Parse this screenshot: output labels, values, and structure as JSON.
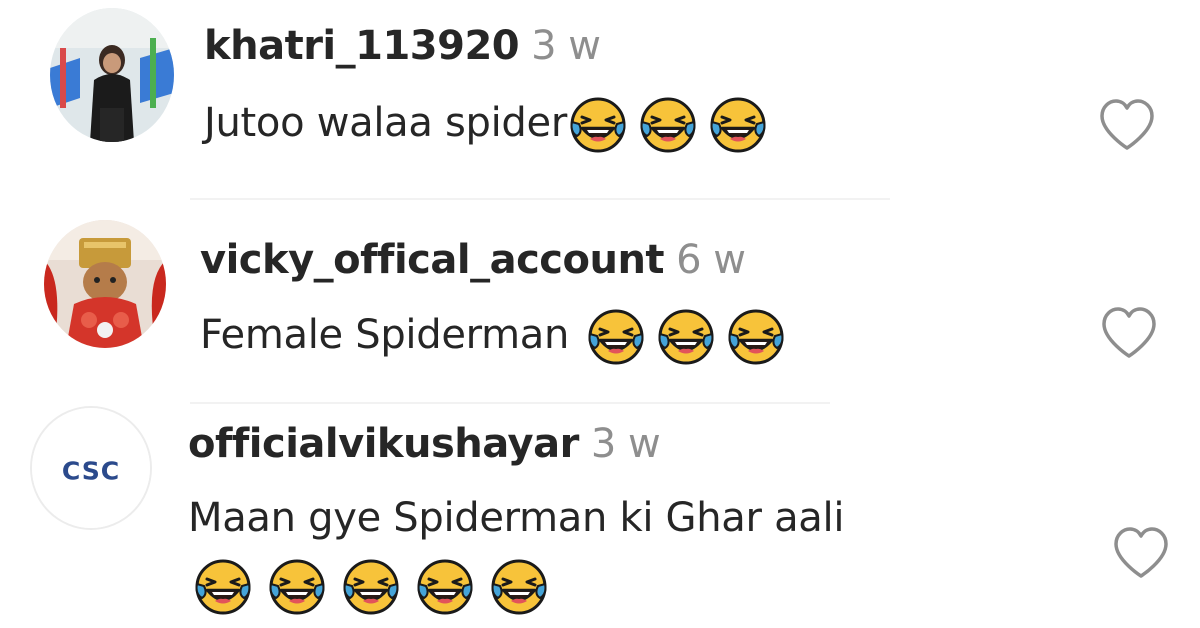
{
  "comments": [
    {
      "username": "khatri_113920",
      "time": "3 w",
      "text": "Jutoo walaa spider",
      "text_line2": "",
      "emoji_count": 3,
      "avatar_icon": "person-photo"
    },
    {
      "username": "vicky_offical_account",
      "time": "6 w",
      "text": "Female Spiderman",
      "text_line2": "",
      "emoji_count": 3,
      "avatar_icon": "statue-photo"
    },
    {
      "username": "officialvikushayar",
      "time": "3 w",
      "text": "Maan gye Spiderman ki Ghar aali",
      "text_line2": "",
      "emoji_count": 5,
      "avatar_icon": "csc-logo",
      "avatar_logo_text": "CSC"
    }
  ],
  "icons": {
    "emoji": "face-with-tears-of-joy-icon",
    "like": "heart-outline-icon"
  },
  "colors": {
    "username": "#262626",
    "time": "#8e8e8e",
    "text": "#262626",
    "heart_outline": "#8e8e8e",
    "emoji_face": "#f7c33a",
    "emoji_tears": "#45a4d8"
  }
}
